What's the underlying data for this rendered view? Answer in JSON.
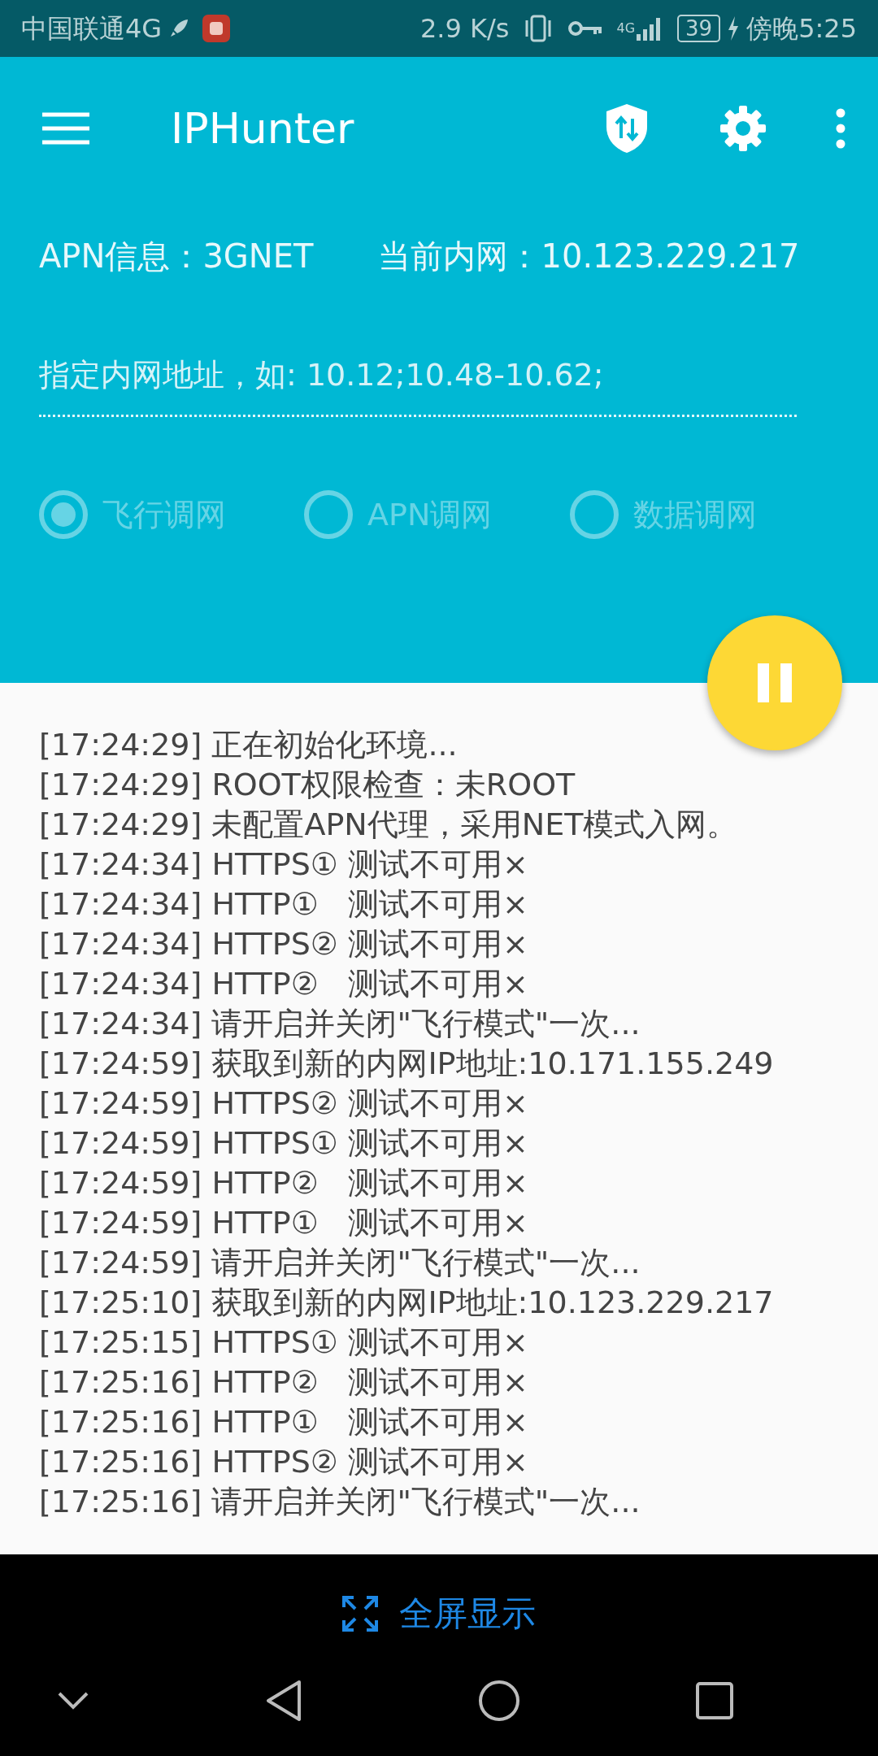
{
  "status_bar": {
    "carrier": "中国联通4G",
    "speed": "2.9 K/s",
    "network": "4G",
    "battery": "39",
    "time": "傍晚5:25"
  },
  "toolbar": {
    "title": "IPHunter"
  },
  "info": {
    "apn": "APN信息：3GNET",
    "inner_ip": "当前内网：10.123.229.217"
  },
  "ip_field": {
    "placeholder": "指定内网地址，如: 10.12;10.48-10.62;"
  },
  "modes": [
    {
      "label": "飞行调网",
      "selected": true,
      "disabled": true
    },
    {
      "label": "APN调网",
      "selected": false,
      "disabled": true
    },
    {
      "label": "数据调网",
      "selected": false,
      "disabled": true
    }
  ],
  "log": [
    "[17:24:29] 正在初始化环境...",
    "[17:24:29] ROOT权限检查：未ROOT",
    "[17:24:29] 未配置APN代理，采用NET模式入网。",
    "[17:24:34] HTTPS① 测试不可用×",
    "[17:24:34] HTTP①   测试不可用×",
    "[17:24:34] HTTPS② 测试不可用×",
    "[17:24:34] HTTP②   测试不可用×",
    "[17:24:34] 请开启并关闭\"飞行模式\"一次...",
    "[17:24:59] 获取到新的内网IP地址:10.171.155.249",
    "[17:24:59] HTTPS② 测试不可用×",
    "[17:24:59] HTTPS① 测试不可用×",
    "[17:24:59] HTTP②   测试不可用×",
    "[17:24:59] HTTP①   测试不可用×",
    "[17:24:59] 请开启并关闭\"飞行模式\"一次...",
    "[17:25:10] 获取到新的内网IP地址:10.123.229.217",
    "[17:25:15] HTTPS① 测试不可用×",
    "[17:25:16] HTTP②   测试不可用×",
    "[17:25:16] HTTP①   测试不可用×",
    "[17:25:16] HTTPS② 测试不可用×",
    "[17:25:16] 请开启并关闭\"飞行模式\"一次..."
  ],
  "fullscreen_button": {
    "label": "全屏显示"
  }
}
